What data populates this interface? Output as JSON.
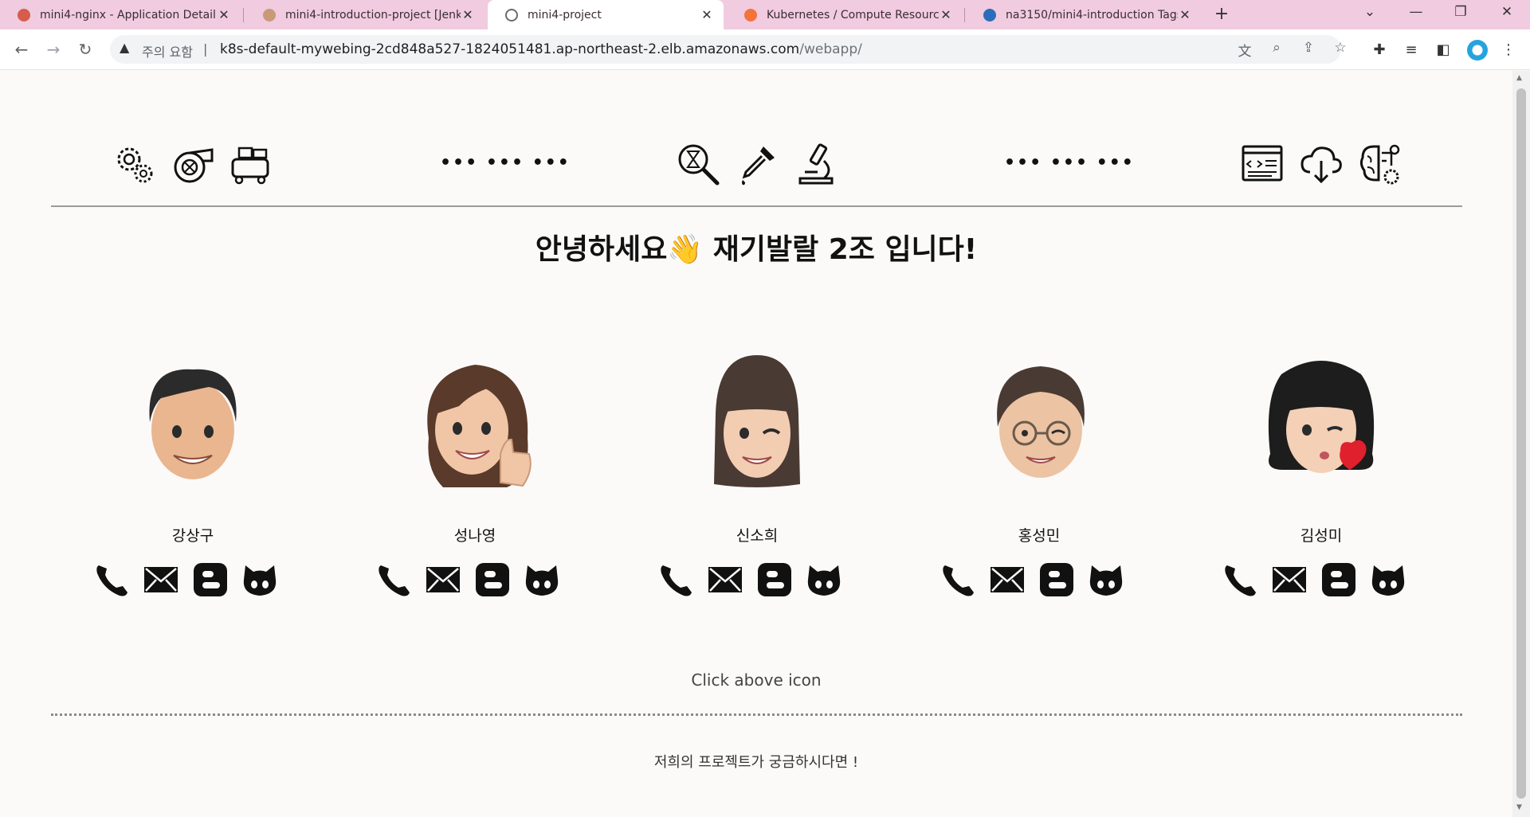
{
  "browser": {
    "tabs": [
      {
        "title": "mini4-nginx - Application Detail",
        "favicon_color": "#d65d4c"
      },
      {
        "title": "mini4-introduction-project [Jenk",
        "favicon_color": "#c99a78"
      },
      {
        "title": "mini4-project",
        "favicon_color": "#6b6b6b",
        "active": true
      },
      {
        "title": "Kubernetes / Compute Resourc",
        "favicon_color": "#f4733b"
      },
      {
        "title": "na3150/mini4-introduction Tags",
        "favicon_color": "#2a6ebb"
      }
    ],
    "security_label": "주의 요함",
    "url_host": "k8s-default-mywebing-2cd848a527-1824051481.ap-northeast-2.elb.amazonaws.com",
    "url_path": "/webapp/",
    "accent_color": "#f1cbe0"
  },
  "header": {
    "left_icons": [
      "gears-icon",
      "turbine-icon",
      "compressor-icon"
    ],
    "center_icons": [
      "magnifier-hourglass-icon",
      "pipette-icon",
      "microscope-icon"
    ],
    "right_icons": [
      "code-window-icon",
      "cloud-download-icon",
      "brain-gear-icon"
    ],
    "dots_left": "••• ••• •••",
    "dots_right": "••• ••• •••"
  },
  "greeting": "안녕하세요👋 재기발랄 2조 입니다!",
  "members": [
    {
      "name": "강상구",
      "avatar": "boy-smile-avatar",
      "hair": "#2b2b2b"
    },
    {
      "name": "성나영",
      "avatar": "girl-thumbs-up-avatar",
      "hair": "#5a3a2a"
    },
    {
      "name": "신소희",
      "avatar": "girl-wink-avatar",
      "hair": "#4a3a34"
    },
    {
      "name": "홍성민",
      "avatar": "boy-glasses-avatar",
      "hair": "#4a3a34"
    },
    {
      "name": "김성미",
      "avatar": "girl-heart-kiss-avatar",
      "hair": "#1d1d1d"
    }
  ],
  "contact_icons": [
    "phone-icon",
    "mail-icon",
    "blog-icon",
    "github-icon"
  ],
  "caption": "Click above icon",
  "footer": "저희의 프로젝트가 궁금하시다면 !"
}
